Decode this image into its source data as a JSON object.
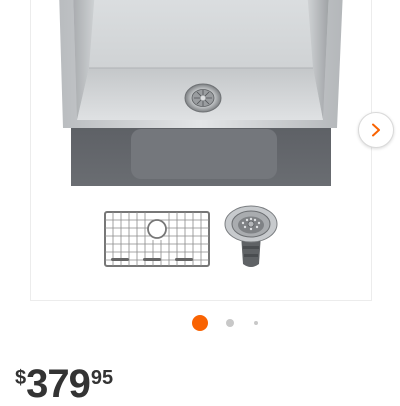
{
  "product": {
    "price": {
      "currency": "$",
      "dollars": "379",
      "cents": "95"
    }
  },
  "gallery": {
    "main_image": "stainless-steel-undermount-sink",
    "thumbnails": [
      "bottom-grid-rack",
      "basket-strainer-drain"
    ],
    "next_icon": "chevron-right-icon",
    "dots_total": 3,
    "dots_active": 1,
    "accent_color": "#f96302"
  }
}
